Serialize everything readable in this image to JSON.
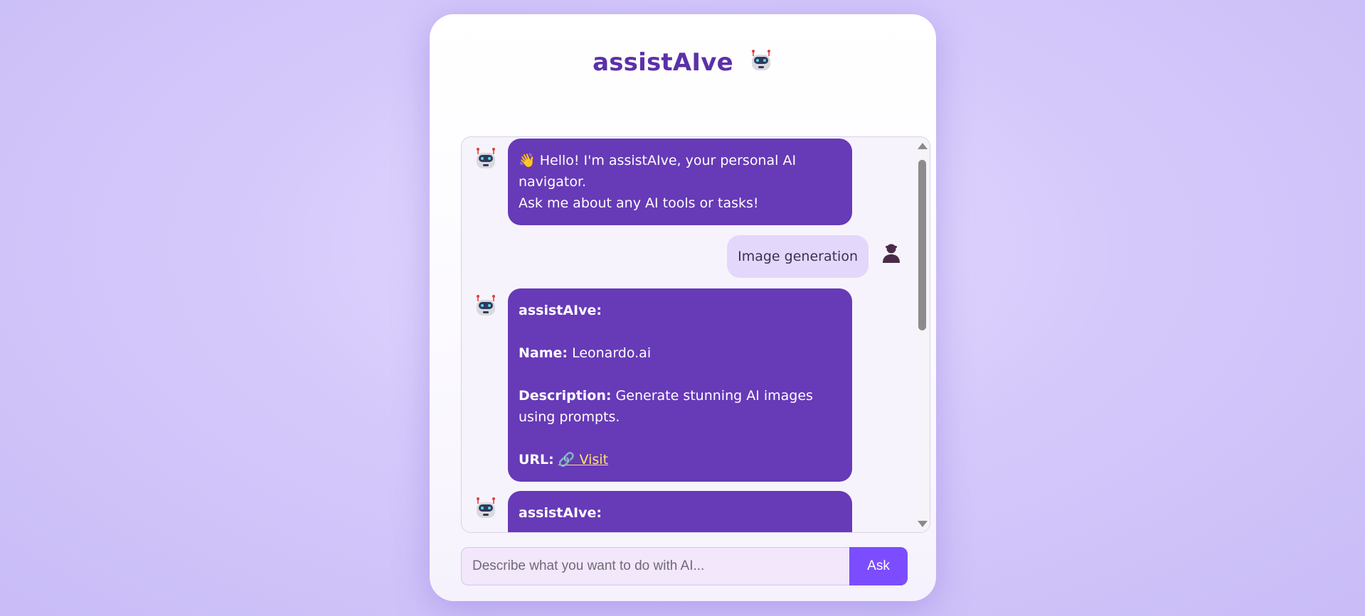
{
  "app": {
    "title": "assistAIve",
    "title_icon": "robot-icon"
  },
  "colors": {
    "accent": "#673ab7",
    "button": "#7c4dff",
    "title": "#5b31a8",
    "link": "#ffe36e",
    "user_bubble": "#e3d7fb"
  },
  "chat": {
    "messages": [
      {
        "role": "bot",
        "greeting_emoji": "👋",
        "line1": "Hello! I'm assistAIve, your personal AI navigator.",
        "line2": "Ask me about any AI tools or tasks!"
      },
      {
        "role": "user",
        "text": "Image generation",
        "icon": "user-icon"
      },
      {
        "role": "bot",
        "sender": "assistAIve:",
        "name_label": "Name:",
        "name_value": "Leonardo.ai",
        "description_label": "Description:",
        "description_value": "Generate stunning AI images using prompts.",
        "url_label": "URL:",
        "url_icon": "🔗",
        "url_text": "Visit"
      },
      {
        "role": "bot",
        "sender": "assistAIve:"
      }
    ]
  },
  "input": {
    "placeholder": "Describe what you want to do with AI...",
    "value": ""
  },
  "ask_button": {
    "label": "Ask"
  }
}
